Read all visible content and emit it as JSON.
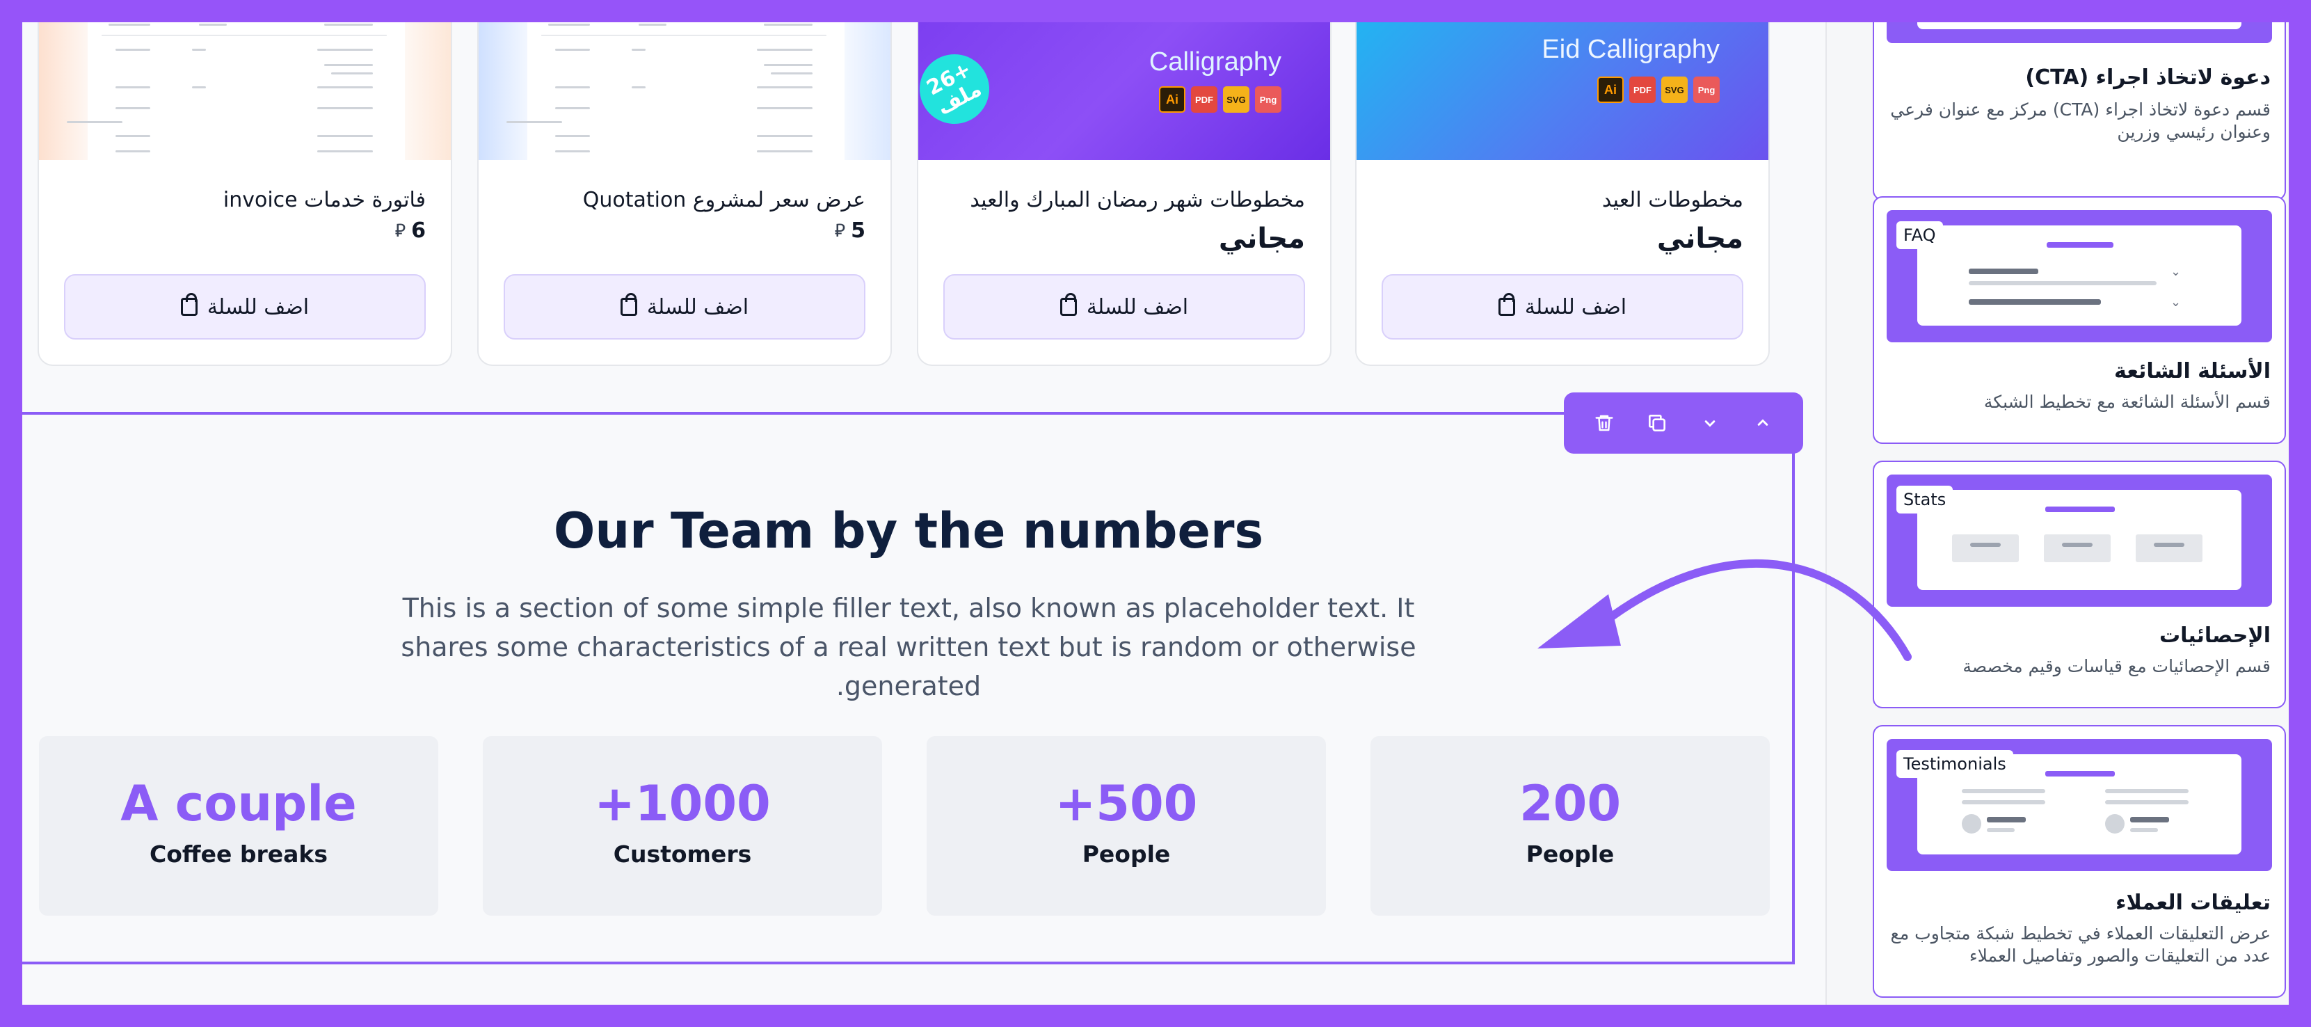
{
  "products": [
    {
      "title": "فاتورة خدمات invoice",
      "price": "6",
      "currency_symbol": "⃁",
      "cart_label": "اضف للسلة"
    },
    {
      "title": "عرض سعر لمشروع Quotation",
      "price": "5",
      "currency_symbol": "⃁",
      "cart_label": "اضف للسلة"
    },
    {
      "title": "مخطوطات شهر رمضان المبارك والعيد",
      "price": "مجاني",
      "cart_label": "اضف للسلة",
      "thumb_text": "Calligraphy",
      "badge": "26+\nملف",
      "file_icons": [
        "Ai",
        "PDF",
        "SVG",
        "Png"
      ]
    },
    {
      "title": "مخطوطات العيد",
      "price": "مجاني",
      "cart_label": "اضف للسلة",
      "thumb_text": "Eid Calligraphy",
      "file_icons": [
        "Ai",
        "PDF",
        "SVG",
        "Png"
      ]
    }
  ],
  "toolbar": {
    "icons": [
      "trash-icon",
      "duplicate-icon",
      "chevron-down-icon",
      "chevron-up-icon"
    ]
  },
  "stats_section": {
    "heading": "Our Team by the numbers",
    "description": "This is a section of some simple filler text, also known as placeholder text. It shares some characteristics of a real written text but is random or otherwise generated.",
    "stats": [
      {
        "value": "A couple",
        "label": "Coffee breaks"
      },
      {
        "value": "1000+",
        "label": "Customers"
      },
      {
        "value": "500+",
        "label": "People"
      },
      {
        "value": "200",
        "label": "People"
      }
    ]
  },
  "sidebar": {
    "blocks": [
      {
        "tag": "",
        "title": "دعوة لاتخاذ اجراء (CTA)",
        "description": "قسم دعوة لاتخاذ اجراء (CTA) مركز مع عنوان فرعي وعنوان رئيسي وزرين"
      },
      {
        "tag": "FAQ",
        "title": "الأسئلة الشائعة",
        "description": "قسم الأسئلة الشائعة مع تخطيط الشبكة"
      },
      {
        "tag": "Stats",
        "title": "الإحصائيات",
        "description": "قسم الإحصائيات مع قياسات وقيم مخصصة"
      },
      {
        "tag": "Testimonials",
        "title": "تعليقات العملاء",
        "description": "عرض التعليقات العملاء في تخطيط شبكة متجاوب مع عدد من التعليقات والصور وتفاصيل العملاء"
      }
    ]
  },
  "colors": {
    "brand": "#8b5cf6",
    "background_frame": "#9654f9",
    "heading": "#0f1f3d"
  }
}
